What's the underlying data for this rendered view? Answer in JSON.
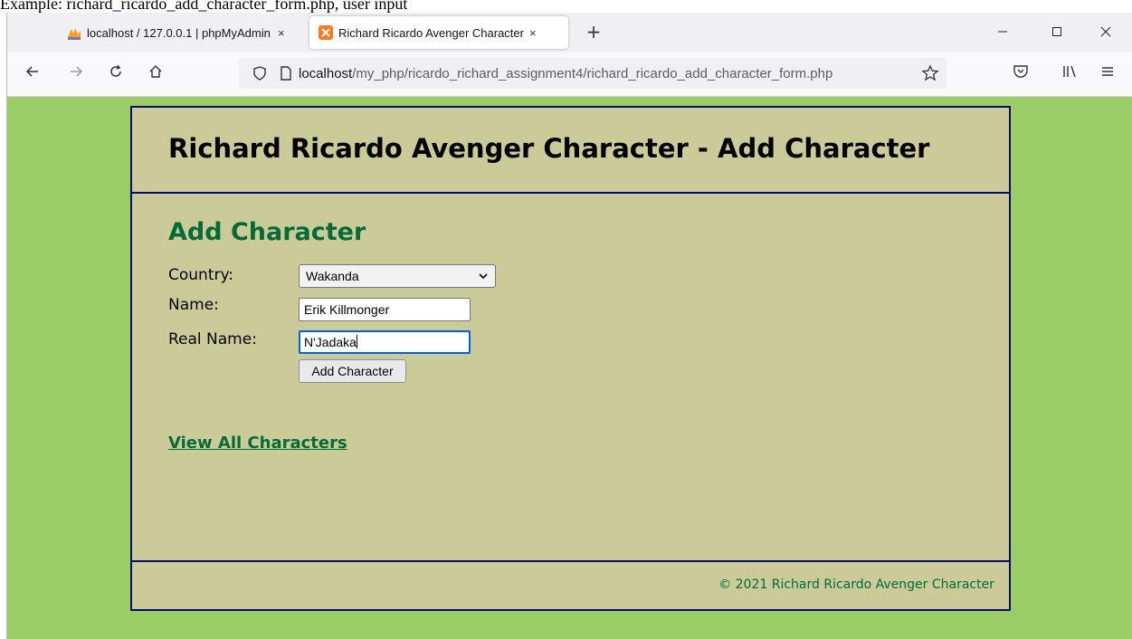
{
  "caption": "Example: richard_ricardo_add_character_form.php, user input",
  "browser": {
    "tabs": [
      {
        "label": "localhost / 127.0.0.1 | phpMyAdmin",
        "close": "×"
      },
      {
        "label": "Richard Ricardo Avenger Character",
        "close": "×"
      }
    ],
    "new_tab": "+",
    "url_host": "localhost",
    "url_path": "/my_php/ricardo_richard_assignment4/richard_ricardo_add_character_form.php"
  },
  "page": {
    "header_title": "Richard Ricardo Avenger Character - Add Character",
    "heading": "Add Character",
    "form": {
      "country_label": "Country:",
      "country_value": "Wakanda",
      "name_label": "Name:",
      "name_value": "Erik Killmonger",
      "real_name_label": "Real Name:",
      "real_name_value": "N'Jadaka",
      "submit_label": "Add Character"
    },
    "view_all_link": "View All Characters",
    "footer_text": "© 2021 Richard Ricardo Avenger Character"
  },
  "colors": {
    "page_bg": "#9acd65",
    "container_bg": "#cbcb9a",
    "border": "#0a0a6e",
    "accent_green": "#006b37"
  }
}
